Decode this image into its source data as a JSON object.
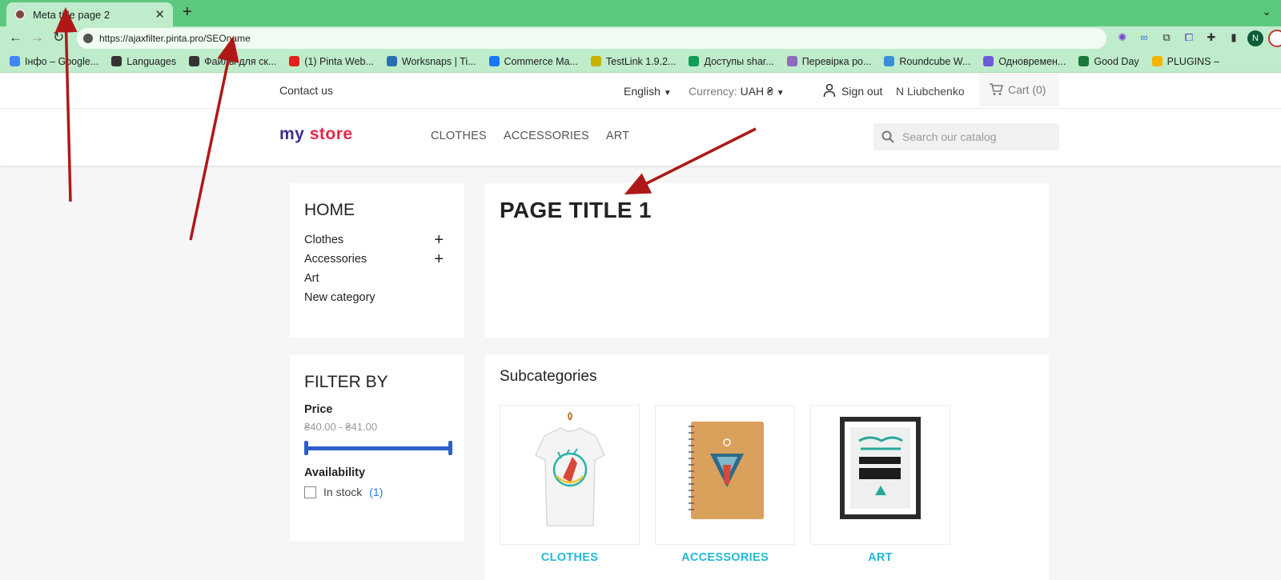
{
  "browser": {
    "tab_title": "Meta title page 2",
    "url": "https://ajaxfilter.pinta.pro/SEOname",
    "profile_initial": "N",
    "bookmarks": [
      {
        "label": "Інфо – Google...",
        "color": "#4285f4"
      },
      {
        "label": "Languages",
        "color": "#333333"
      },
      {
        "label": "Файлы для ск...",
        "color": "#333333"
      },
      {
        "label": "(1) Pinta Web...",
        "color": "#e62117"
      },
      {
        "label": "Worksnaps | Ti...",
        "color": "#2a6db5"
      },
      {
        "label": "Commerce Ma...",
        "color": "#1877f2"
      },
      {
        "label": "TestLink 1.9.2...",
        "color": "#c9b100"
      },
      {
        "label": "Доступы shar...",
        "color": "#0f9d58"
      },
      {
        "label": "Перевірка ро...",
        "color": "#8e6bbf"
      },
      {
        "label": "Roundcube W...",
        "color": "#3a8fd8"
      },
      {
        "label": "Одновремен...",
        "color": "#6a5cd8"
      },
      {
        "label": "Good Day",
        "color": "#1a7a3a"
      },
      {
        "label": "PLUGINS –",
        "color": "#f4b400"
      }
    ]
  },
  "header": {
    "contact": "Contact us",
    "language": "English",
    "currency_label": "Currency:",
    "currency_value": "UAH ₴",
    "sign_out": "Sign out",
    "user_name": "N Liubchenko",
    "cart": "Cart (0)"
  },
  "nav": {
    "logo_m": "my",
    "logo_s": "store",
    "menu": [
      "CLOTHES",
      "ACCESSORIES",
      "ART"
    ],
    "search_placeholder": "Search our catalog"
  },
  "sidebar": {
    "home_title": "HOME",
    "categories": [
      {
        "label": "Clothes",
        "expandable": true
      },
      {
        "label": "Accessories",
        "expandable": true
      },
      {
        "label": "Art",
        "expandable": false
      },
      {
        "label": "New category",
        "expandable": false
      }
    ]
  },
  "filter": {
    "title": "FILTER BY",
    "price_label": "Price",
    "price_range": "₴40.00 - ₴41.00",
    "availability_label": "Availability",
    "in_stock_label": "In stock",
    "in_stock_count": "(1)"
  },
  "main": {
    "page_title": "PAGE TITLE 1",
    "subcategories_title": "Subcategories",
    "subcategories": [
      {
        "name": "CLOTHES"
      },
      {
        "name": "ACCESSORIES"
      },
      {
        "name": "ART"
      }
    ]
  },
  "colors": {
    "tab_bar": "#5cc87d",
    "chrome": "#bfeccb",
    "link_accent": "#24b9d7",
    "slider": "#2c5fcc",
    "annotation": "#b01818"
  }
}
